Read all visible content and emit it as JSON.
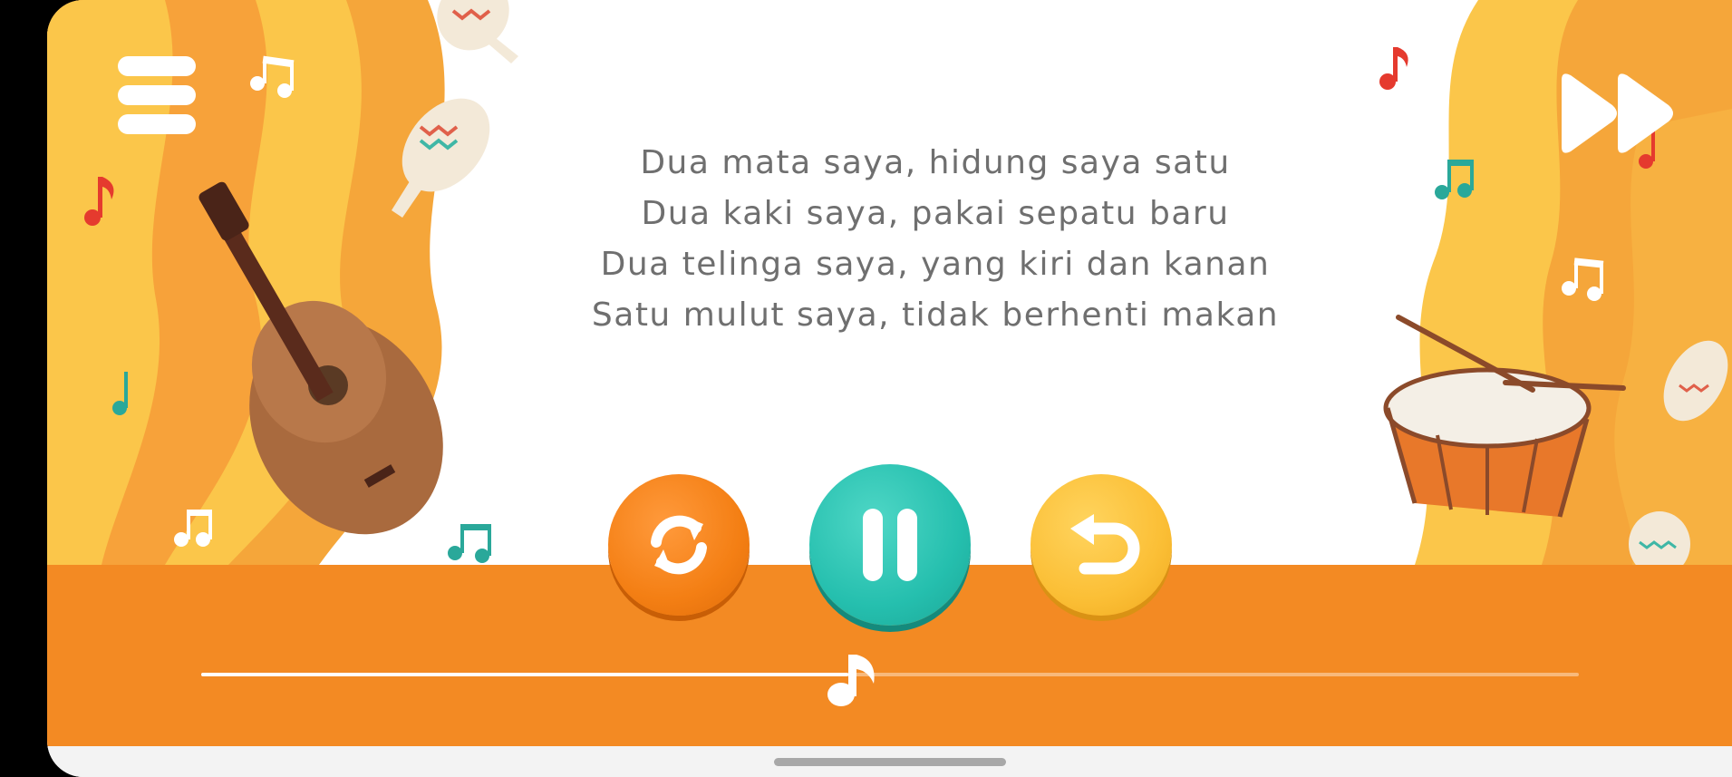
{
  "lyrics": {
    "lines": [
      "Dua mata saya, hidung saya satu",
      "Dua kaki saya, pakai sepatu baru",
      "Dua telinga saya, yang kiri dan kanan",
      "Satu mulut saya, tidak berhenti makan"
    ]
  },
  "controls": {
    "menu_icon": "hamburger-menu-icon",
    "skip_icon": "fast-forward-icon",
    "repeat_icon": "repeat-icon",
    "pause_icon": "pause-icon",
    "back_icon": "replay-back-icon"
  },
  "progress": {
    "fraction": 0.47,
    "thumb_icon": "music-note-icon"
  },
  "colors": {
    "bar": "#f38a23",
    "repeat_button": "#f47f14",
    "pause_button": "#25bfae",
    "back_button": "#fbbf36",
    "lyrics_text": "#6f6f6f"
  }
}
